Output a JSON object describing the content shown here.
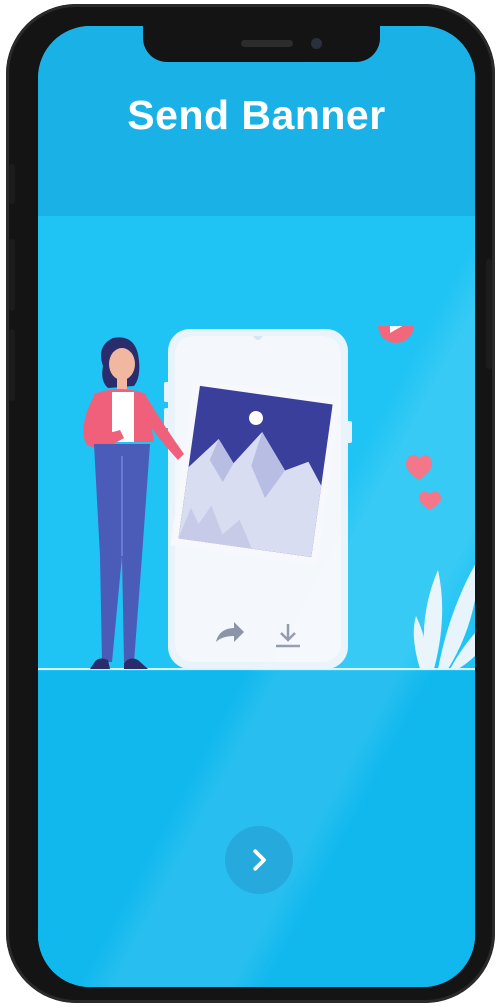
{
  "screen": {
    "title": "Send Banner"
  },
  "illustration": {
    "icons": [
      "play-icon",
      "heart-icon",
      "share-arrow-icon",
      "download-icon",
      "mountain-photo",
      "woman-figure",
      "plant-leaves"
    ]
  },
  "navigation": {
    "next_icon": "chevron-right-icon"
  },
  "colors": {
    "screen_bg": "#20c4f4",
    "header_bg": "#1ab2e6",
    "accent_pink": "#f2677c",
    "button_bg": "#0d9fd8",
    "frame": "#141414"
  }
}
